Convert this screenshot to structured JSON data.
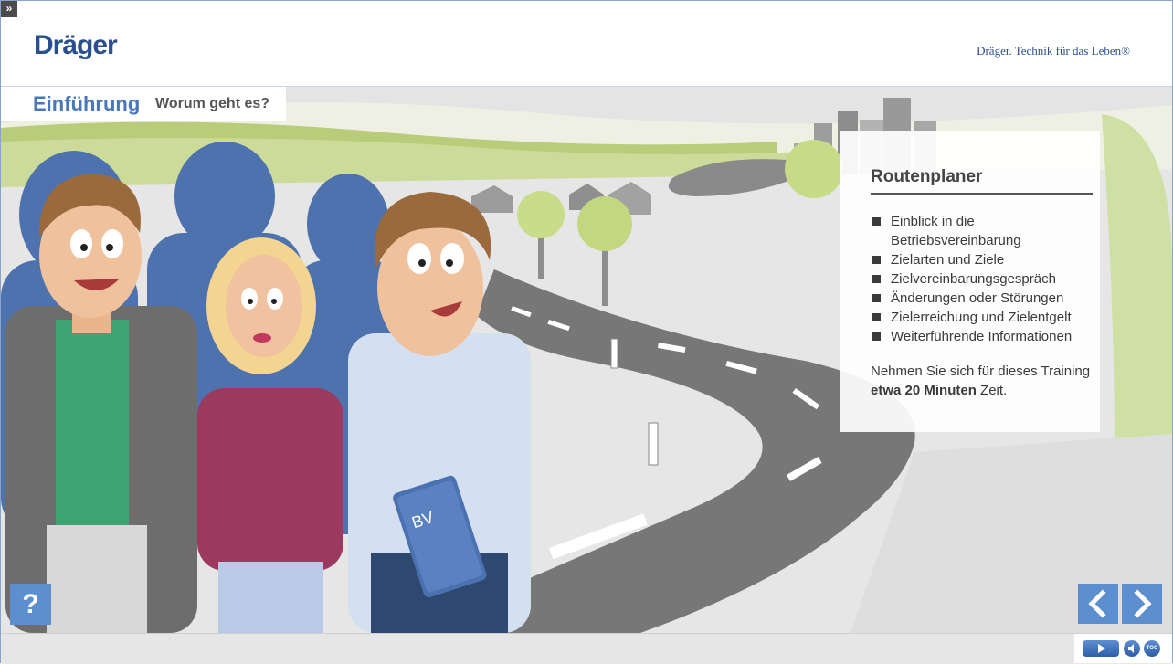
{
  "header": {
    "logo_text": "Dräger",
    "slogan": "Dräger. Technik für das Leben®",
    "expand_icon": "double-chevron-right-icon",
    "expand_glyph": "»"
  },
  "title": {
    "main": "Einführung",
    "sub": "Worum geht es?"
  },
  "scene": {
    "folder_label": "BV"
  },
  "panel": {
    "title": "Routenplaner",
    "items": [
      "Einblick in die Betriebsvereinbarung",
      "Zielarten und Ziele",
      "Zielvereinbarungsgespräch",
      "Änderungen oder Störungen",
      "Zielerreichung und Zielentgelt",
      "Weiterführende Informationen"
    ],
    "note_before": "Nehmen Sie sich für dieses Training ",
    "note_bold": "etwa 20 Minuten",
    "note_after": " Zeit."
  },
  "buttons": {
    "help_label": "?",
    "prev_icon": "chevron-left-icon",
    "next_icon": "chevron-right-icon"
  },
  "controls": {
    "play_icon": "play-icon",
    "volume_icon": "speaker-icon",
    "toc_label": "TOC"
  },
  "colors": {
    "brand_blue": "#2a4f8f",
    "accent_blue": "#5c8ed0",
    "title_blue": "#4a77b7"
  }
}
